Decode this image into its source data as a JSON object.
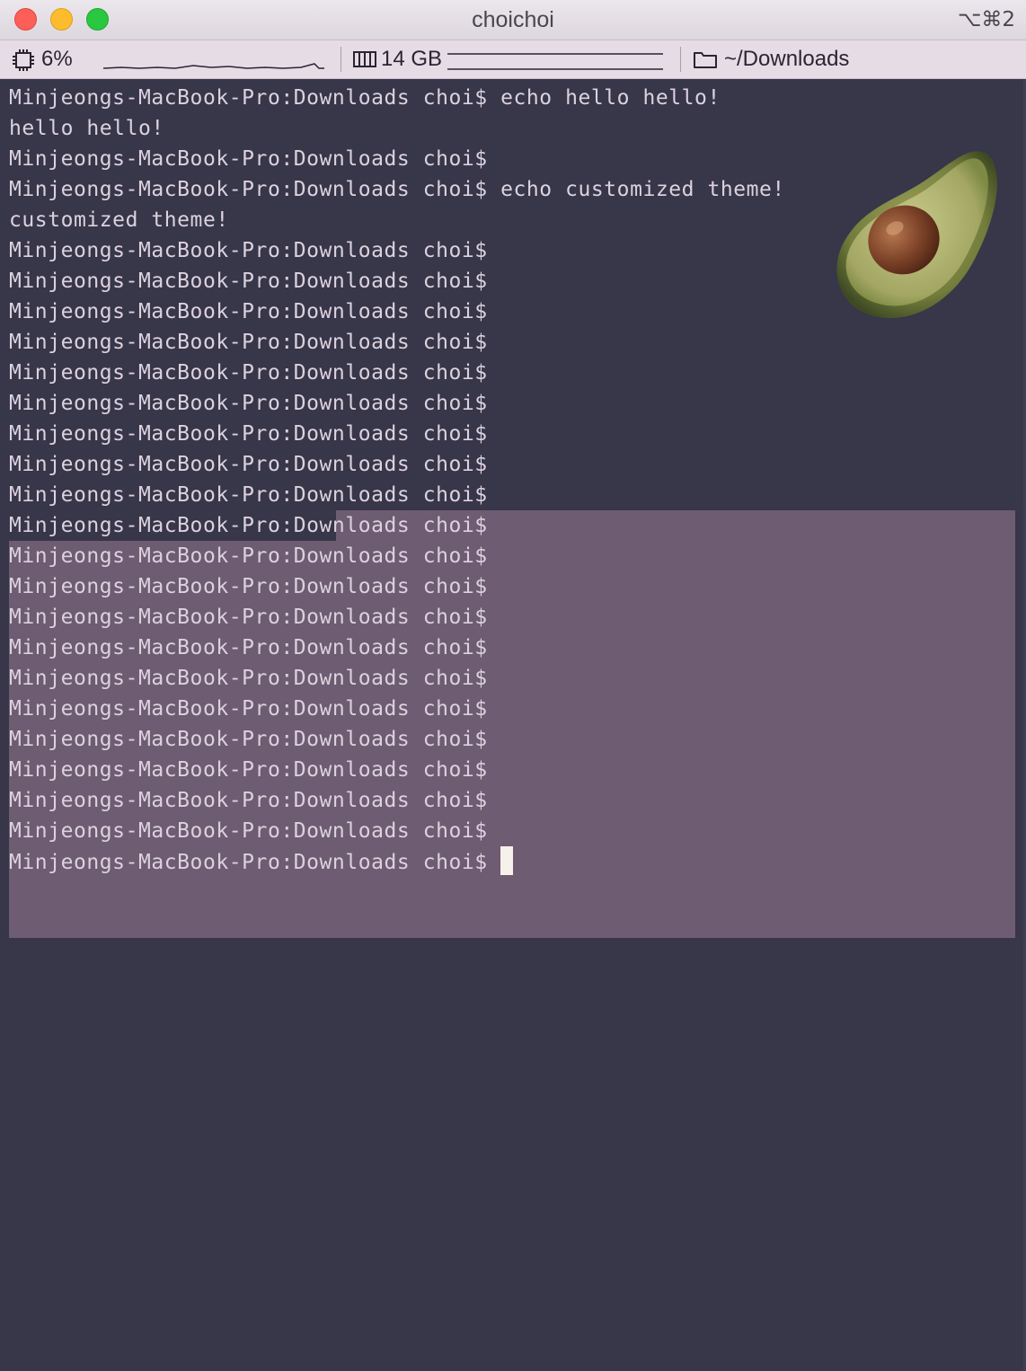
{
  "window": {
    "title": "choichoi",
    "shortcut": "⌥⌘2"
  },
  "statusbar": {
    "cpu": "6%",
    "memory": "14 GB",
    "directory": "~/Downloads"
  },
  "terminal": {
    "lines": [
      "Minjeongs-MacBook-Pro:Downloads choi$ echo hello hello!",
      "hello hello!",
      "Minjeongs-MacBook-Pro:Downloads choi$",
      "Minjeongs-MacBook-Pro:Downloads choi$ echo customized theme!",
      "customized theme!",
      "Minjeongs-MacBook-Pro:Downloads choi$",
      "Minjeongs-MacBook-Pro:Downloads choi$",
      "Minjeongs-MacBook-Pro:Downloads choi$",
      "Minjeongs-MacBook-Pro:Downloads choi$",
      "Minjeongs-MacBook-Pro:Downloads choi$",
      "Minjeongs-MacBook-Pro:Downloads choi$",
      "Minjeongs-MacBook-Pro:Downloads choi$",
      "Minjeongs-MacBook-Pro:Downloads choi$",
      "Minjeongs-MacBook-Pro:Downloads choi$",
      "Minjeongs-MacBook-Pro:Downloads choi$",
      "Minjeongs-MacBook-Pro:Downloads choi$",
      "Minjeongs-MacBook-Pro:Downloads choi$",
      "Minjeongs-MacBook-Pro:Downloads choi$",
      "Minjeongs-MacBook-Pro:Downloads choi$",
      "Minjeongs-MacBook-Pro:Downloads choi$",
      "Minjeongs-MacBook-Pro:Downloads choi$",
      "Minjeongs-MacBook-Pro:Downloads choi$",
      "Minjeongs-MacBook-Pro:Downloads choi$",
      "Minjeongs-MacBook-Pro:Downloads choi$",
      "Minjeongs-MacBook-Pro:Downloads choi$",
      "Minjeongs-MacBook-Pro:Downloads choi$"
    ]
  },
  "colors": {
    "background": "#383649",
    "foreground": "#dcd2de",
    "selection": "#6e5c72",
    "cursor": "#f6f1ea",
    "titlebar": "#e5dce6"
  },
  "icons": [
    "cpu-icon",
    "memory-icon",
    "folder-icon",
    "avocado-icon"
  ]
}
